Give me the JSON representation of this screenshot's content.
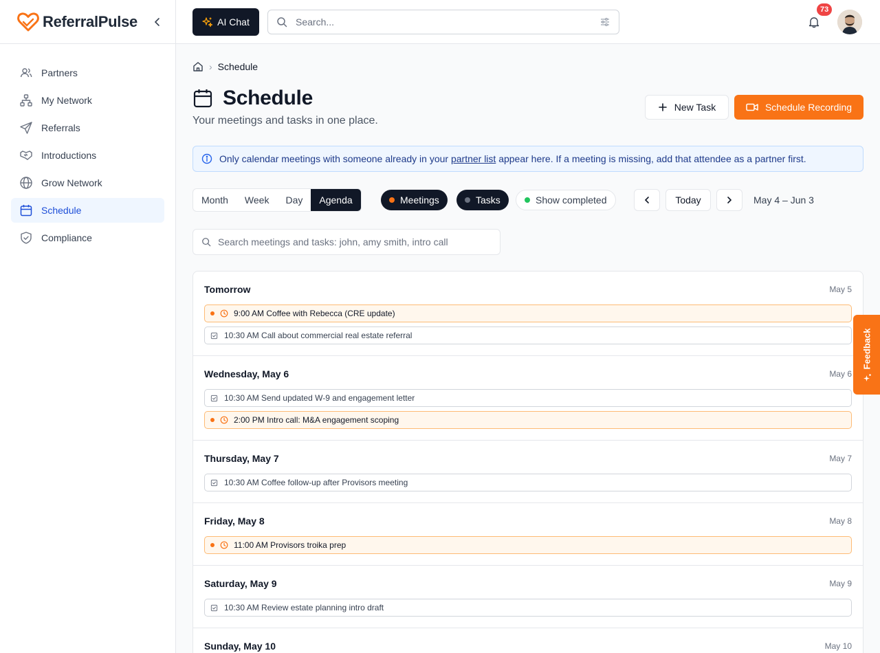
{
  "brand": {
    "name": "ReferralPulse"
  },
  "sidebar": {
    "items": [
      {
        "label": "Partners",
        "icon": "users-icon"
      },
      {
        "label": "My Network",
        "icon": "network-icon"
      },
      {
        "label": "Referrals",
        "icon": "send-icon"
      },
      {
        "label": "Introductions",
        "icon": "handshake-icon"
      },
      {
        "label": "Grow Network",
        "icon": "globe-icon"
      },
      {
        "label": "Schedule",
        "icon": "calendar-icon",
        "active": true
      },
      {
        "label": "Compliance",
        "icon": "shield-check-icon"
      }
    ]
  },
  "topbar": {
    "ai_chat_label": "AI Chat",
    "search_placeholder": "Search...",
    "notification_count": "73"
  },
  "breadcrumb": {
    "current": "Schedule"
  },
  "page": {
    "title": "Schedule",
    "subtitle": "Your meetings and tasks in one place.",
    "new_task_label": "New Task",
    "schedule_recording_label": "Schedule Recording"
  },
  "banner": {
    "text_before": "Only calendar meetings with someone already in your ",
    "link": "partner list",
    "text_after": " appear here. If a meeting is missing, add that attendee as a partner first."
  },
  "views": [
    "Month",
    "Week",
    "Day",
    "Agenda"
  ],
  "active_view": "Agenda",
  "filters": {
    "meetings": "Meetings",
    "tasks": "Tasks",
    "show_completed": "Show completed"
  },
  "nav": {
    "today_label": "Today",
    "range": "May 4 – Jun 3"
  },
  "list_search_placeholder": "Search meetings and tasks: john, amy smith, intro call",
  "agenda": {
    "days": [
      {
        "title": "Tomorrow",
        "date": "May 5",
        "events": [
          {
            "type": "meeting",
            "text": "9:00 AM Coffee with Rebecca (CRE update)"
          },
          {
            "type": "task",
            "text": "10:30 AM Call about commercial real estate referral"
          }
        ]
      },
      {
        "title": "Wednesday, May 6",
        "date": "May 6",
        "events": [
          {
            "type": "task",
            "text": "10:30 AM Send updated W-9 and engagement letter"
          },
          {
            "type": "meeting",
            "text": "2:00 PM Intro call: M&A engagement scoping"
          }
        ]
      },
      {
        "title": "Thursday, May 7",
        "date": "May 7",
        "events": [
          {
            "type": "task",
            "text": "10:30 AM Coffee follow-up after Provisors meeting"
          }
        ]
      },
      {
        "title": "Friday, May 8",
        "date": "May 8",
        "events": [
          {
            "type": "meeting",
            "text": "11:00 AM Provisors troika prep"
          }
        ]
      },
      {
        "title": "Saturday, May 9",
        "date": "May 9",
        "events": [
          {
            "type": "task",
            "text": "10:30 AM Review estate planning intro draft"
          }
        ]
      },
      {
        "title": "Sunday, May 10",
        "date": "May 10",
        "events": []
      }
    ]
  },
  "feedback_label": "Feedback",
  "colors": {
    "accent": "#f97316",
    "active_nav": "#1d4ed8",
    "dark": "#111827"
  }
}
